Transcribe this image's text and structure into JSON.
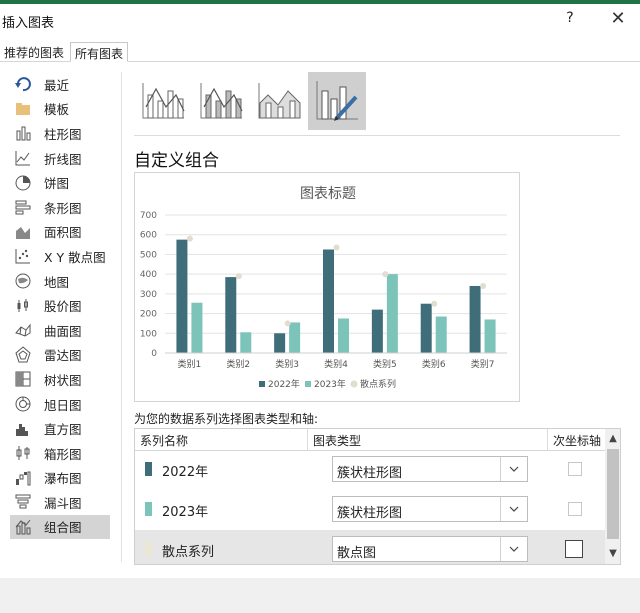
{
  "window": {
    "title": "插入图表",
    "help": "?",
    "close": "✕"
  },
  "tabs": [
    "推荐的图表",
    "所有图表"
  ],
  "sidebar": {
    "items": [
      {
        "label": "最近",
        "icon": "recent-icon"
      },
      {
        "label": "模板",
        "icon": "folder-icon"
      },
      {
        "label": "柱形图",
        "icon": "column-chart-icon"
      },
      {
        "label": "折线图",
        "icon": "line-chart-icon"
      },
      {
        "label": "饼图",
        "icon": "pie-chart-icon"
      },
      {
        "label": "条形图",
        "icon": "bar-chart-icon"
      },
      {
        "label": "面积图",
        "icon": "area-chart-icon"
      },
      {
        "label": "X Y 散点图",
        "icon": "scatter-chart-icon"
      },
      {
        "label": "地图",
        "icon": "map-chart-icon"
      },
      {
        "label": "股价图",
        "icon": "stock-chart-icon"
      },
      {
        "label": "曲面图",
        "icon": "surface-chart-icon"
      },
      {
        "label": "雷达图",
        "icon": "radar-chart-icon"
      },
      {
        "label": "树状图",
        "icon": "treemap-chart-icon"
      },
      {
        "label": "旭日图",
        "icon": "sunburst-chart-icon"
      },
      {
        "label": "直方图",
        "icon": "histogram-chart-icon"
      },
      {
        "label": "箱形图",
        "icon": "box-chart-icon"
      },
      {
        "label": "瀑布图",
        "icon": "waterfall-chart-icon"
      },
      {
        "label": "漏斗图",
        "icon": "funnel-chart-icon"
      },
      {
        "label": "组合图",
        "icon": "combo-chart-icon"
      }
    ],
    "selected": "组合图"
  },
  "combo": {
    "section_title": "自定义组合",
    "instruction": "为您的数据系列选择图表类型和轴:",
    "grid_headers": [
      "系列名称",
      "图表类型",
      "次坐标轴"
    ],
    "rows": [
      {
        "name": "2022年",
        "type": "簇状柱形图",
        "color": "#3f6e7a",
        "secondary": false
      },
      {
        "name": "2023年",
        "type": "簇状柱形图",
        "color": "#7cc3b9",
        "secondary": false
      },
      {
        "name": "散点系列",
        "type": "散点图",
        "color": "#ece6d4",
        "secondary": false
      }
    ]
  },
  "colors": {
    "accent_bar": "#217346",
    "series2022": "#3f6e7a",
    "series2023": "#7cc3b9",
    "scatter": "#e2ddce"
  },
  "chart_data": {
    "type": "bar",
    "title": "图表标题",
    "categories": [
      "类别1",
      "类别2",
      "类别3",
      "类别4",
      "类别5",
      "类别6",
      "类别7"
    ],
    "series": [
      {
        "name": "2022年",
        "values": [
          575,
          385,
          100,
          525,
          220,
          250,
          340
        ]
      },
      {
        "name": "2023年",
        "values": [
          255,
          105,
          155,
          175,
          400,
          185,
          170
        ]
      },
      {
        "name": "散点系列",
        "values": [
          580,
          390,
          150,
          535,
          400,
          250,
          340
        ]
      }
    ],
    "yticks": [
      0,
      100,
      200,
      300,
      400,
      500,
      600,
      700
    ],
    "ylim": [
      0,
      700
    ],
    "grid": true,
    "legend": "bottom"
  }
}
